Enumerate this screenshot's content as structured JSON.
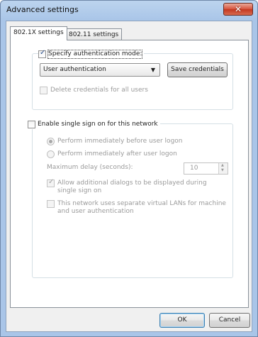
{
  "window": {
    "title": "Advanced settings",
    "close_glyph": "✕"
  },
  "tabs": [
    {
      "label": "802.1X settings",
      "active": true
    },
    {
      "label": "802.11 settings",
      "active": false
    }
  ],
  "auth_group": {
    "specify_mode_label": "Specify authentication mode:",
    "specify_mode_checked": true,
    "mode_selected": "User authentication",
    "save_credentials_label": "Save credentials",
    "delete_credentials_label": "Delete credentials for all users",
    "delete_credentials_checked": false
  },
  "sso_group": {
    "enable_label": "Enable single sign on for this network",
    "enable_checked": false,
    "before_logon_label": "Perform immediately before user logon",
    "before_logon_selected": true,
    "after_logon_label": "Perform immediately after user logon",
    "max_delay_label": "Maximum delay (seconds):",
    "max_delay_value": "10",
    "allow_dialogs_label": "Allow additional dialogs to be displayed during single sign on",
    "allow_dialogs_checked": true,
    "separate_vlan_label": "This network uses separate virtual LANs for machine and user authentication",
    "separate_vlan_checked": false
  },
  "footer": {
    "ok_label": "OK",
    "cancel_label": "Cancel"
  }
}
